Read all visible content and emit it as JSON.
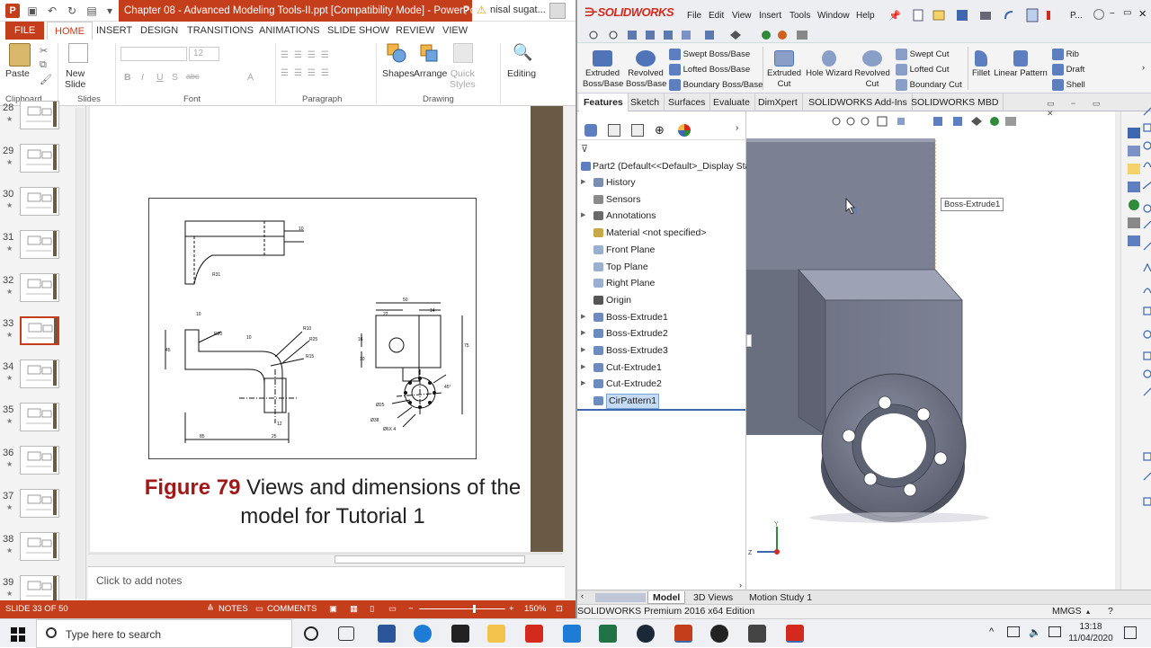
{
  "ppt": {
    "window_title": "Chapter 08 - Advanced Modeling Tools-II.ppt [Compatibility Mode] - PowerPoint (Pr...",
    "account": "nisal sugat...",
    "tabs": [
      "FILE",
      "HOME",
      "INSERT",
      "DESIGN",
      "TRANSITIONS",
      "ANIMATIONS",
      "SLIDE SHOW",
      "REVIEW",
      "VIEW"
    ],
    "ribbon": {
      "paste": "Paste",
      "new_slide": "New\nSlide",
      "font_size": "12",
      "font_buttons": [
        "B",
        "I",
        "U",
        "S",
        "abc",
        "A"
      ],
      "shapes": "Shapes",
      "arrange": "Arrange",
      "quick_styles": "Quick\nStyles",
      "editing": "Editing",
      "groups": [
        "Clipboard",
        "Slides",
        "Font",
        "Paragraph",
        "Drawing"
      ]
    },
    "thumbnails": [
      {
        "num": "28",
        "selected": false
      },
      {
        "num": "29",
        "selected": false
      },
      {
        "num": "30",
        "selected": false
      },
      {
        "num": "31",
        "selected": false
      },
      {
        "num": "32",
        "selected": false
      },
      {
        "num": "33",
        "selected": true
      },
      {
        "num": "34",
        "selected": false
      },
      {
        "num": "35",
        "selected": false
      },
      {
        "num": "36",
        "selected": false
      },
      {
        "num": "37",
        "selected": false
      },
      {
        "num": "38",
        "selected": false
      },
      {
        "num": "39",
        "selected": false
      }
    ],
    "thumb_star": "★",
    "drawing_dims": {
      "top_10a": "10",
      "top_r31": "R31",
      "front_10a": "10",
      "front_r20": "R20",
      "front_10b": "10",
      "front_r10": "R10",
      "front_r25": "R25",
      "front_r15": "R15",
      "front_45": "45",
      "front_12": "12",
      "front_85": "85",
      "front_25": "25",
      "side_50": "50",
      "side_22": "22",
      "side_14": "14",
      "side_16": "16",
      "side_10": "10",
      "side_75": "75",
      "side_45deg": "45°",
      "side_d25": "Ø25",
      "side_d38": "Ø38",
      "side_d6x4": "Ø6X 4"
    },
    "caption_fig": "Figure 79",
    "caption_rest": " Views and dimensions of the model for Tutorial 1",
    "notes_placeholder": "Click to add notes",
    "status": {
      "slide": "SLIDE 33 OF 50",
      "notes": "NOTES",
      "comments": "COMMENTS",
      "zoom": "150%"
    }
  },
  "sw": {
    "logo": "SOLIDWORKS",
    "menus": [
      "File",
      "Edit",
      "View",
      "Insert",
      "Tools",
      "Window",
      "Help"
    ],
    "user_short": "P...",
    "commands": {
      "extruded_boss": "Extruded\nBoss/Base",
      "revolved_boss": "Revolved\nBoss/Base",
      "swept_boss": "Swept Boss/Base",
      "lofted_boss": "Lofted Boss/Base",
      "boundary_boss": "Boundary Boss/Base",
      "extruded_cut": "Extruded\nCut",
      "hole_wizard": "Hole Wizard",
      "revolved_cut": "Revolved\nCut",
      "swept_cut": "Swept Cut",
      "lofted_cut": "Lofted Cut",
      "boundary_cut": "Boundary Cut",
      "fillet": "Fillet",
      "linear_pattern": "Linear Pattern",
      "rib": "Rib",
      "draft": "Draft",
      "shell": "Shell"
    },
    "command_tabs": [
      "Features",
      "Sketch",
      "Surfaces",
      "Evaluate",
      "DimXpert",
      "SOLIDWORKS Add-Ins",
      "SOLIDWORKS MBD"
    ],
    "tree": {
      "root": "Part2  (Default<<Default>_Display Sta",
      "items": [
        {
          "label": "History",
          "arrow": true,
          "color": "#7a8fb0"
        },
        {
          "label": "Sensors",
          "arrow": false,
          "color": "#8a8a8a"
        },
        {
          "label": "Annotations",
          "arrow": true,
          "color": "#6a6a6a"
        },
        {
          "label": "Material <not specified>",
          "arrow": false,
          "color": "#c9a84a"
        },
        {
          "label": "Front Plane",
          "arrow": false,
          "color": "#9ab0d0"
        },
        {
          "label": "Top Plane",
          "arrow": false,
          "color": "#9ab0d0"
        },
        {
          "label": "Right Plane",
          "arrow": false,
          "color": "#9ab0d0"
        },
        {
          "label": "Origin",
          "arrow": false,
          "color": "#555555"
        },
        {
          "label": "Boss-Extrude1",
          "arrow": true,
          "color": "#6d8bbf"
        },
        {
          "label": "Boss-Extrude2",
          "arrow": true,
          "color": "#6d8bbf"
        },
        {
          "label": "Boss-Extrude3",
          "arrow": true,
          "color": "#6d8bbf"
        },
        {
          "label": "Cut-Extrude1",
          "arrow": true,
          "color": "#6d8bbf"
        },
        {
          "label": "Cut-Extrude2",
          "arrow": true,
          "color": "#6d8bbf"
        },
        {
          "label": "CirPattern1",
          "arrow": false,
          "color": "#6d8bbf",
          "selected": true
        }
      ]
    },
    "tooltip": "Boss-Extrude1",
    "axis_y": "Y",
    "axis_z": "Z",
    "bottom_tabs": [
      "Model",
      "3D Views",
      "Motion Study 1"
    ],
    "status_text": "SOLIDWORKS Premium 2016 x64 Edition",
    "units": "MMGS"
  },
  "taskbar": {
    "search_placeholder": "Type here to search",
    "time": "13:18",
    "date": "11/04/2020"
  },
  "colors": {
    "ppt_accent": "#c43e1c",
    "sw_red": "#d32a1d",
    "model_gray": "#7e8496",
    "slide_side_bar": "#6b5a43"
  }
}
